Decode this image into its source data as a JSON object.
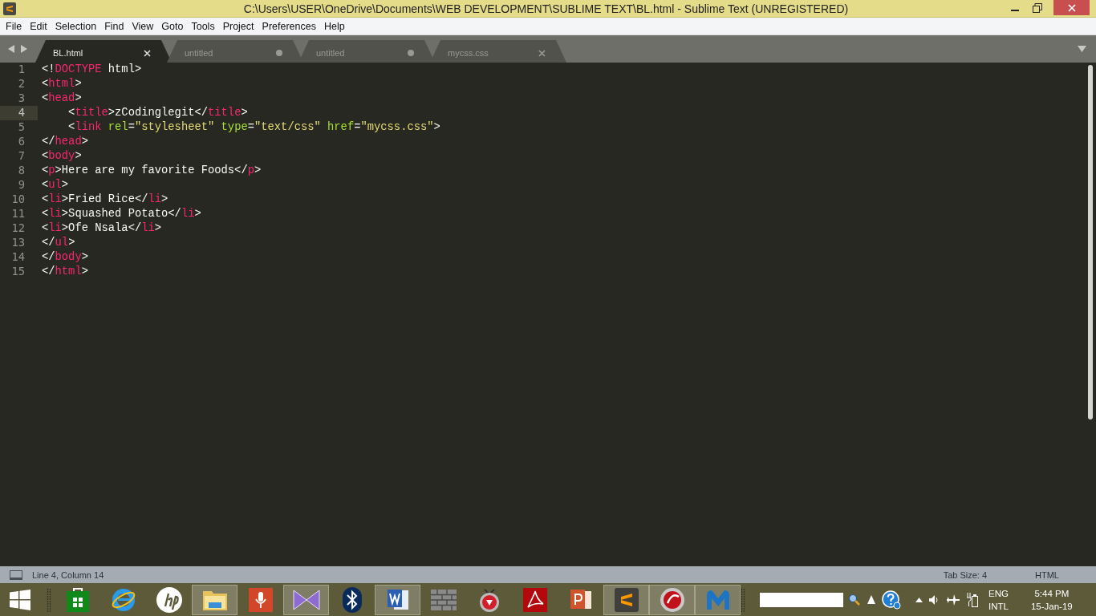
{
  "window": {
    "title": "C:\\Users\\USER\\OneDrive\\Documents\\WEB DEVELOPMENT\\SUBLIME TEXT\\BL.html - Sublime Text (UNREGISTERED)"
  },
  "menu": [
    "File",
    "Edit",
    "Selection",
    "Find",
    "View",
    "Goto",
    "Tools",
    "Project",
    "Preferences",
    "Help"
  ],
  "tabs": [
    {
      "label": "BL.html",
      "selected": true,
      "modified": false
    },
    {
      "label": "untitled",
      "selected": false,
      "modified": true
    },
    {
      "label": "untitled",
      "selected": false,
      "modified": true
    },
    {
      "label": "mycss.css",
      "selected": false,
      "modified": false
    }
  ],
  "editor": {
    "lines": [
      {
        "number": "1",
        "current": false,
        "tokens": [
          {
            "kind": "plain",
            "text": "<!"
          },
          {
            "kind": "tag",
            "text": "DOCTYPE"
          },
          {
            "kind": "plain",
            "text": " html>"
          }
        ]
      },
      {
        "number": "2",
        "current": false,
        "tokens": [
          {
            "kind": "plain",
            "text": "<"
          },
          {
            "kind": "tag",
            "text": "html"
          },
          {
            "kind": "plain",
            "text": ">"
          }
        ]
      },
      {
        "number": "3",
        "current": false,
        "tokens": [
          {
            "kind": "plain",
            "text": "<"
          },
          {
            "kind": "tag",
            "text": "head"
          },
          {
            "kind": "plain",
            "text": ">"
          }
        ]
      },
      {
        "number": "4",
        "current": true,
        "tokens": [
          {
            "kind": "plain",
            "text": "    <"
          },
          {
            "kind": "tag",
            "text": "title"
          },
          {
            "kind": "plain",
            "text": ">zCodinglegit</"
          },
          {
            "kind": "tag",
            "text": "title"
          },
          {
            "kind": "plain",
            "text": ">"
          }
        ]
      },
      {
        "number": "5",
        "current": false,
        "tokens": [
          {
            "kind": "plain",
            "text": "    <"
          },
          {
            "kind": "tag",
            "text": "link"
          },
          {
            "kind": "attr",
            "text": " rel"
          },
          {
            "kind": "plain",
            "text": "="
          },
          {
            "kind": "string",
            "text": "\"stylesheet\""
          },
          {
            "kind": "attr",
            "text": " type"
          },
          {
            "kind": "plain",
            "text": "="
          },
          {
            "kind": "string",
            "text": "\"text/css\""
          },
          {
            "kind": "attr",
            "text": " href"
          },
          {
            "kind": "plain",
            "text": "="
          },
          {
            "kind": "string",
            "text": "\"mycss.css\""
          },
          {
            "kind": "plain",
            "text": ">"
          }
        ]
      },
      {
        "number": "6",
        "current": false,
        "tokens": [
          {
            "kind": "plain",
            "text": "</"
          },
          {
            "kind": "tag",
            "text": "head"
          },
          {
            "kind": "plain",
            "text": ">"
          }
        ]
      },
      {
        "number": "7",
        "current": false,
        "tokens": [
          {
            "kind": "plain",
            "text": "<"
          },
          {
            "kind": "tag",
            "text": "body"
          },
          {
            "kind": "plain",
            "text": ">"
          }
        ]
      },
      {
        "number": "8",
        "current": false,
        "tokens": [
          {
            "kind": "plain",
            "text": "<"
          },
          {
            "kind": "tag",
            "text": "p"
          },
          {
            "kind": "plain",
            "text": ">Here are my favorite Foods</"
          },
          {
            "kind": "tag",
            "text": "p"
          },
          {
            "kind": "plain",
            "text": ">"
          }
        ]
      },
      {
        "number": "9",
        "current": false,
        "tokens": [
          {
            "kind": "plain",
            "text": "<"
          },
          {
            "kind": "tag",
            "text": "ul"
          },
          {
            "kind": "plain",
            "text": ">"
          }
        ]
      },
      {
        "number": "10",
        "current": false,
        "tokens": [
          {
            "kind": "plain",
            "text": "<"
          },
          {
            "kind": "tag",
            "text": "li"
          },
          {
            "kind": "plain",
            "text": ">Fried Rice</"
          },
          {
            "kind": "tag",
            "text": "li"
          },
          {
            "kind": "plain",
            "text": ">"
          }
        ]
      },
      {
        "number": "11",
        "current": false,
        "tokens": [
          {
            "kind": "plain",
            "text": "<"
          },
          {
            "kind": "tag",
            "text": "li"
          },
          {
            "kind": "plain",
            "text": ">Squashed Potato</"
          },
          {
            "kind": "tag",
            "text": "li"
          },
          {
            "kind": "plain",
            "text": ">"
          }
        ]
      },
      {
        "number": "12",
        "current": false,
        "tokens": [
          {
            "kind": "plain",
            "text": "<"
          },
          {
            "kind": "tag",
            "text": "li"
          },
          {
            "kind": "plain",
            "text": ">Ofe Nsala</"
          },
          {
            "kind": "tag",
            "text": "li"
          },
          {
            "kind": "plain",
            "text": ">"
          }
        ]
      },
      {
        "number": "13",
        "current": false,
        "tokens": [
          {
            "kind": "plain",
            "text": "</"
          },
          {
            "kind": "tag",
            "text": "ul"
          },
          {
            "kind": "plain",
            "text": ">"
          }
        ]
      },
      {
        "number": "14",
        "current": false,
        "tokens": [
          {
            "kind": "plain",
            "text": "</"
          },
          {
            "kind": "tag",
            "text": "body"
          },
          {
            "kind": "plain",
            "text": ">"
          }
        ]
      },
      {
        "number": "15",
        "current": false,
        "tokens": [
          {
            "kind": "plain",
            "text": "</"
          },
          {
            "kind": "tag",
            "text": "html"
          },
          {
            "kind": "plain",
            "text": ">"
          }
        ]
      }
    ]
  },
  "status_bar": {
    "position": "Line 4, Column 14",
    "tab_size": "Tab Size: 4",
    "syntax": "HTML"
  },
  "taskbar": {
    "apps": [
      {
        "kind": "store",
        "active": false
      },
      {
        "kind": "ie",
        "active": false
      },
      {
        "kind": "hp",
        "active": false
      },
      {
        "kind": "explorer",
        "active": true
      },
      {
        "kind": "recorder",
        "active": false
      },
      {
        "kind": "vs",
        "active": true
      },
      {
        "kind": "bluetooth",
        "active": false
      },
      {
        "kind": "word",
        "active": true
      },
      {
        "kind": "firewall",
        "active": false
      },
      {
        "kind": "downloader",
        "active": false
      },
      {
        "kind": "acrobat",
        "active": false
      },
      {
        "kind": "powerpoint",
        "active": false
      },
      {
        "kind": "sublime",
        "active": true
      },
      {
        "kind": "comodo",
        "active": true
      },
      {
        "kind": "malwarebytes",
        "active": true
      }
    ],
    "language": "ENG",
    "layout": "INTL",
    "time": "5:44 PM",
    "date": "15-Jan-19"
  }
}
